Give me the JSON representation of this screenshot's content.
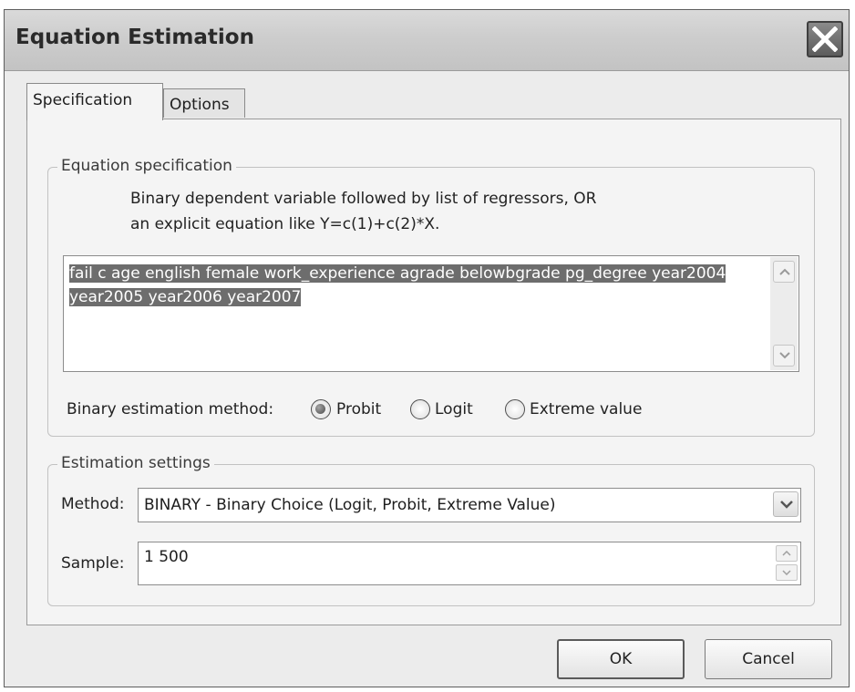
{
  "window": {
    "title": "Equation Estimation",
    "close_icon": "close-icon"
  },
  "tabs": [
    {
      "label": "Specification",
      "active": true
    },
    {
      "label": "Options",
      "active": false
    }
  ],
  "equation_group": {
    "legend": "Equation specification",
    "help_line1": "Binary dependent variable followed by list of regressors, OR",
    "help_line2": "an explicit equation like Y=c(1)+c(2)*X.",
    "equation_text": "fail c age english female work_experience agrade belowbgrade pg_degree year2004 year2005 year2006 year2007",
    "method_label": "Binary estimation method:",
    "method_options": [
      {
        "label": "Probit",
        "selected": true
      },
      {
        "label": "Logit",
        "selected": false
      },
      {
        "label": "Extreme value",
        "selected": false
      }
    ]
  },
  "estimation_group": {
    "legend": "Estimation settings",
    "method_label": "Method:",
    "method_value": "BINARY  -  Binary Choice (Logit, Probit, Extreme Value)",
    "sample_label": "Sample:",
    "sample_value": "1 500"
  },
  "buttons": {
    "ok": "OK",
    "cancel": "Cancel"
  }
}
